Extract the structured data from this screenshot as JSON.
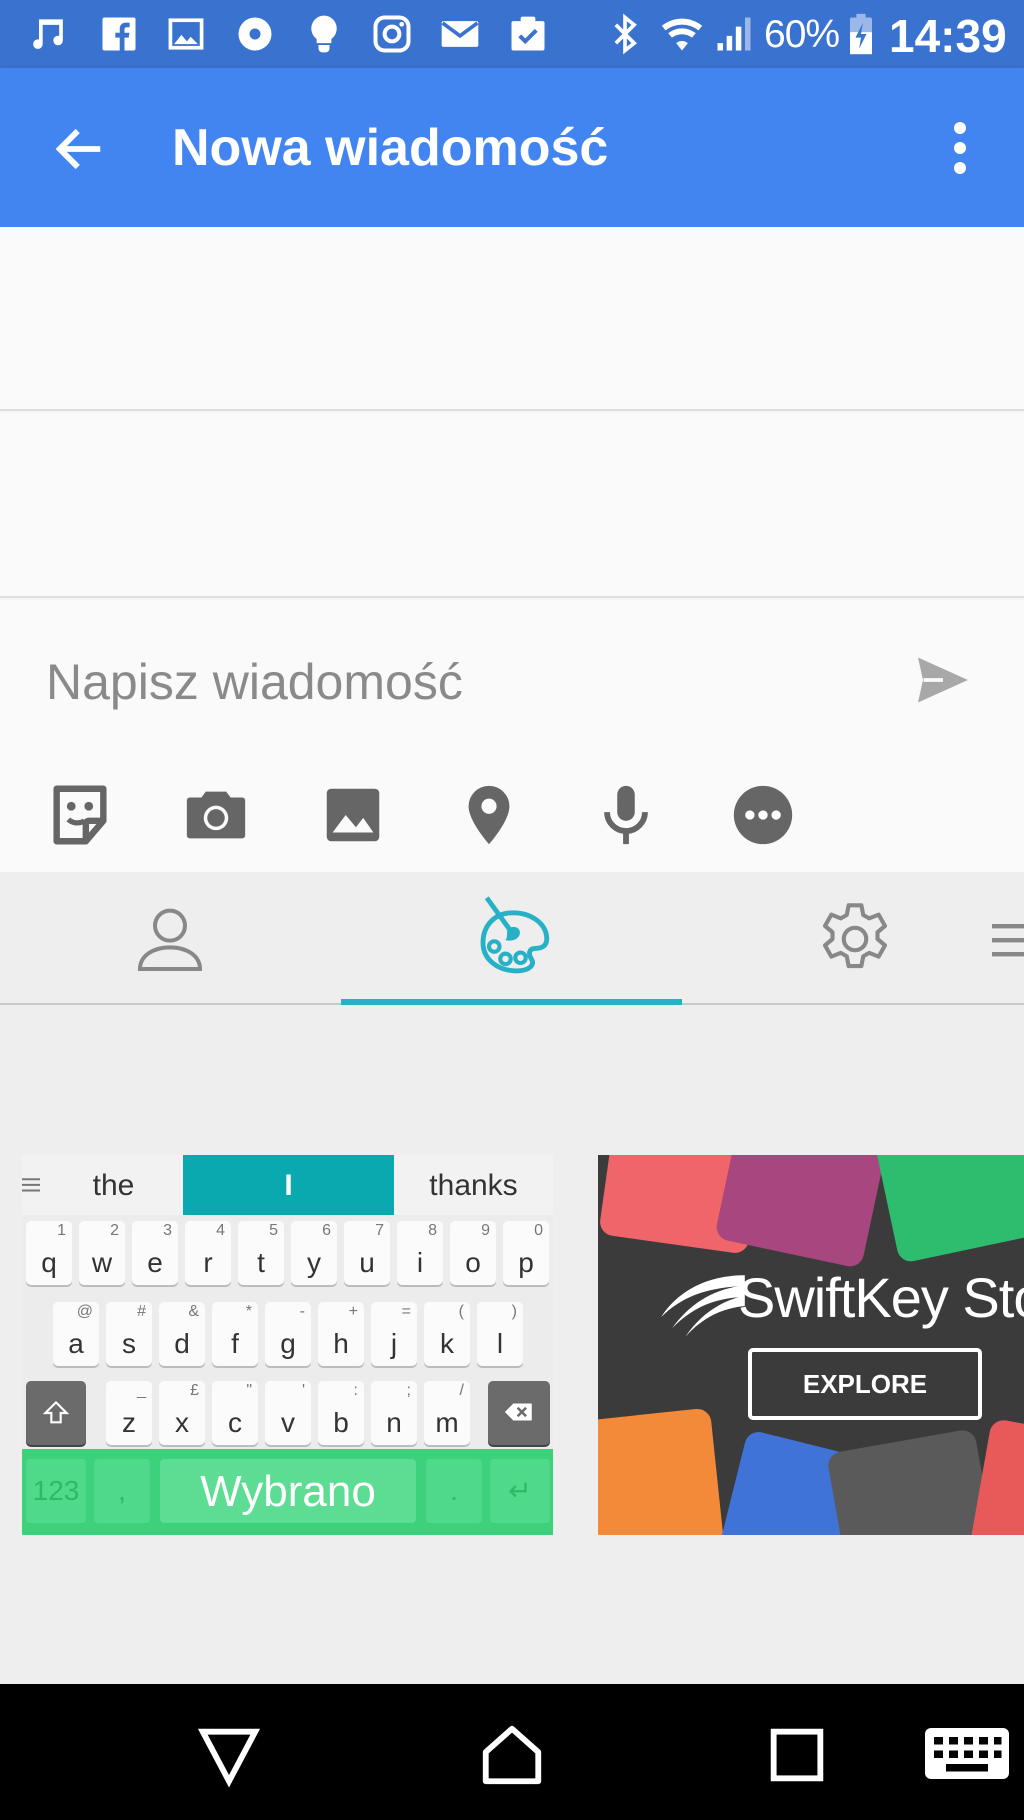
{
  "status_bar": {
    "battery_percent": "60%",
    "time": "14:39",
    "notification_icons": [
      "music-icon",
      "facebook-icon",
      "image-icon",
      "disc-icon",
      "lightbulb-icon",
      "instagram-icon",
      "mail-icon",
      "clipboard-check-icon"
    ],
    "system_icons": [
      "bluetooth-icon",
      "wifi-icon",
      "signal-icon",
      "battery-charging-icon"
    ]
  },
  "app_bar": {
    "title": "Nowa wiadomość",
    "back_icon": "arrow-back-icon",
    "menu_icon": "more-vert-icon"
  },
  "composer": {
    "placeholder": "Napisz wiadomość",
    "value": "",
    "send_icon": "send-icon",
    "attachments": [
      "sticker-icon",
      "camera-icon",
      "image-icon",
      "location-icon",
      "microphone-icon",
      "more-horiz-icon"
    ]
  },
  "keyboard_hub": {
    "tabs": [
      "account-icon",
      "themes-palette-icon",
      "settings-gear-icon",
      "menu-icon"
    ],
    "active_tab": 1,
    "accent_color": "#27b1c6",
    "theme_preview": {
      "predictions": [
        "the",
        "I",
        "thanks"
      ],
      "row1": [
        [
          "q",
          "1"
        ],
        [
          "w",
          "2"
        ],
        [
          "e",
          "3"
        ],
        [
          "r",
          "4"
        ],
        [
          "t",
          "5"
        ],
        [
          "y",
          "6"
        ],
        [
          "u",
          "7"
        ],
        [
          "i",
          "8"
        ],
        [
          "o",
          "9"
        ],
        [
          "p",
          "0"
        ]
      ],
      "row2": [
        [
          "a",
          "@"
        ],
        [
          "s",
          "#"
        ],
        [
          "d",
          "&"
        ],
        [
          "f",
          "*"
        ],
        [
          "g",
          "-"
        ],
        [
          "h",
          "+"
        ],
        [
          "j",
          "="
        ],
        [
          "k",
          "("
        ],
        [
          "l",
          ")"
        ]
      ],
      "row3": [
        [
          "z",
          "_"
        ],
        [
          "x",
          "£"
        ],
        [
          "c",
          "\""
        ],
        [
          "v",
          "'"
        ],
        [
          "b",
          ":"
        ],
        [
          "n",
          ";"
        ],
        [
          "m",
          "/"
        ]
      ],
      "bottom": {
        "numbers": "123",
        "comma": ",",
        "space": "Wybrano",
        "period": ".",
        "enter": "↵",
        "punct": ",!?"
      },
      "selected_label": "Wybrano"
    },
    "store_card": {
      "title": "SwiftKey Store",
      "button": "EXPLORE"
    }
  },
  "nav_bar": {
    "icons": [
      "back-triangle-icon",
      "home-icon",
      "recents-square-icon",
      "keyboard-icon"
    ]
  }
}
